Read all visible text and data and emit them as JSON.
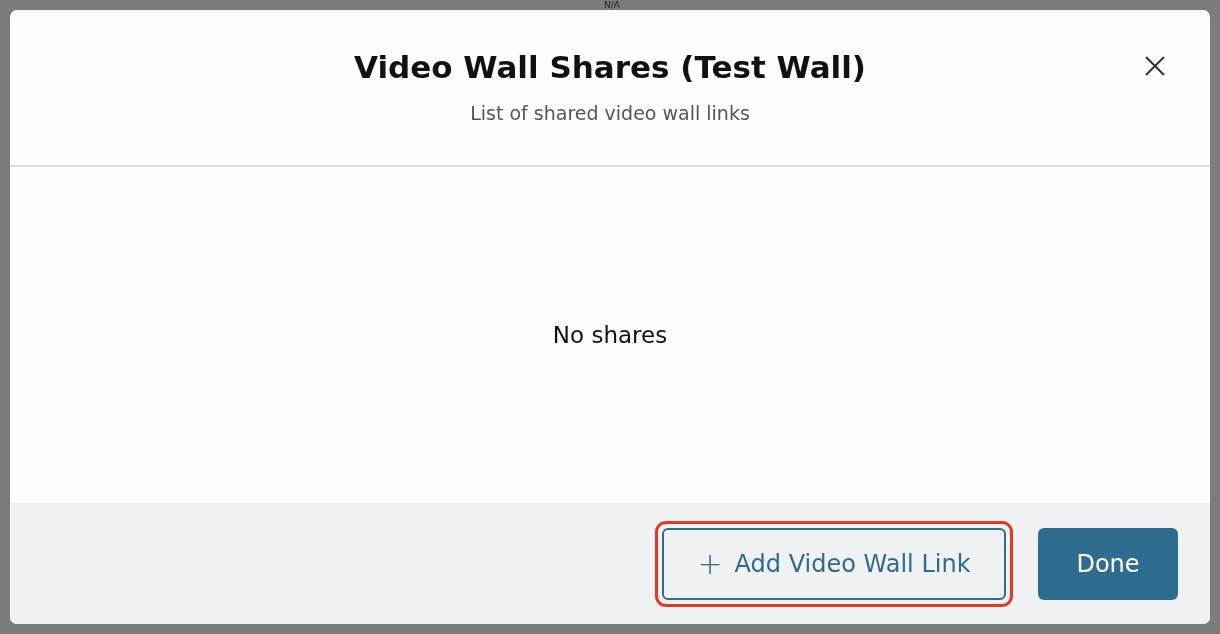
{
  "background": {
    "cell_text": "N/A"
  },
  "dialog": {
    "title": "Video Wall Shares (Test Wall)",
    "subtitle": "List of shared video wall links",
    "empty_message": "No shares",
    "buttons": [
      {
        "kind": "secondary",
        "icon": "+",
        "label": "Add Video Wall Link",
        "highlighted": true
      },
      {
        "kind": "primary",
        "label": "Done",
        "highlighted": false
      }
    ]
  }
}
